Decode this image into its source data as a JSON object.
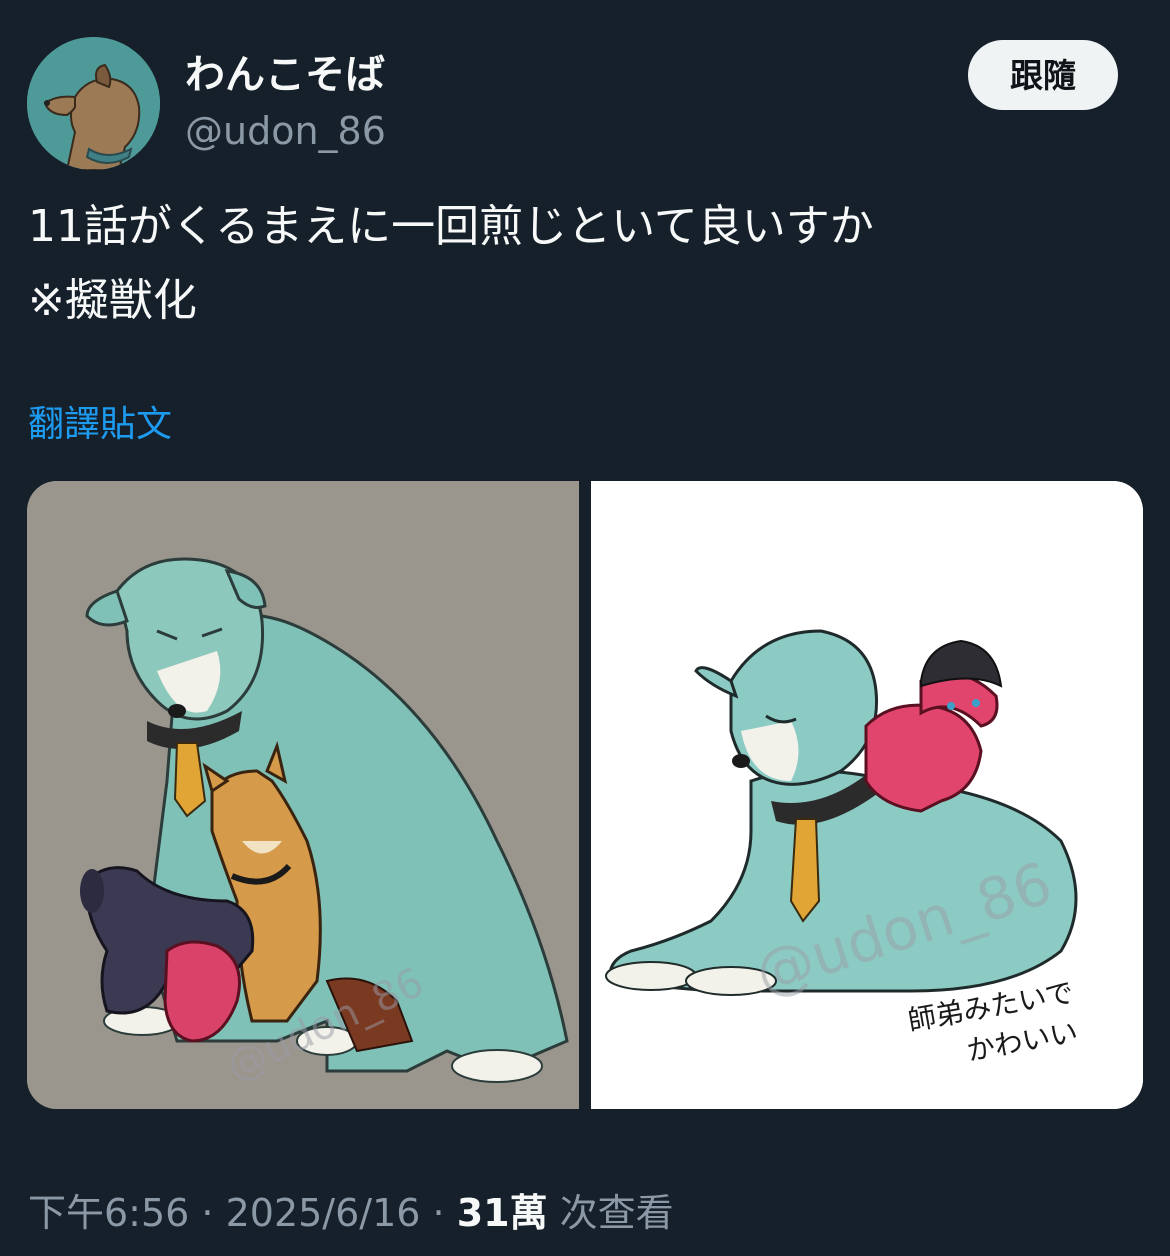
{
  "author": {
    "display_name": "わんこそば",
    "handle": "@udon_86"
  },
  "follow_button": {
    "label": "跟隨"
  },
  "tweet": {
    "lines": [
      "11話がくるまえに一回煎じといて良いすか",
      "※擬獣化"
    ]
  },
  "translate": {
    "label": "翻譯貼文"
  },
  "media": {
    "image1": {
      "watermark": "@udon_86"
    },
    "image2": {
      "watermark": "@udon_86",
      "caption_line1": "師弟みたいで",
      "caption_line2": "かわいい"
    }
  },
  "meta": {
    "time": "下午6:56",
    "sep1": " · ",
    "date": "2025/6/16",
    "sep2": " · ",
    "views_count": "31萬",
    "views_label": " 次查看"
  },
  "colors": {
    "background": "#15202b",
    "text_primary": "#f7f9f9",
    "text_secondary": "#8b98a5",
    "link": "#1d9bf0",
    "follow_bg": "#eff3f4"
  }
}
